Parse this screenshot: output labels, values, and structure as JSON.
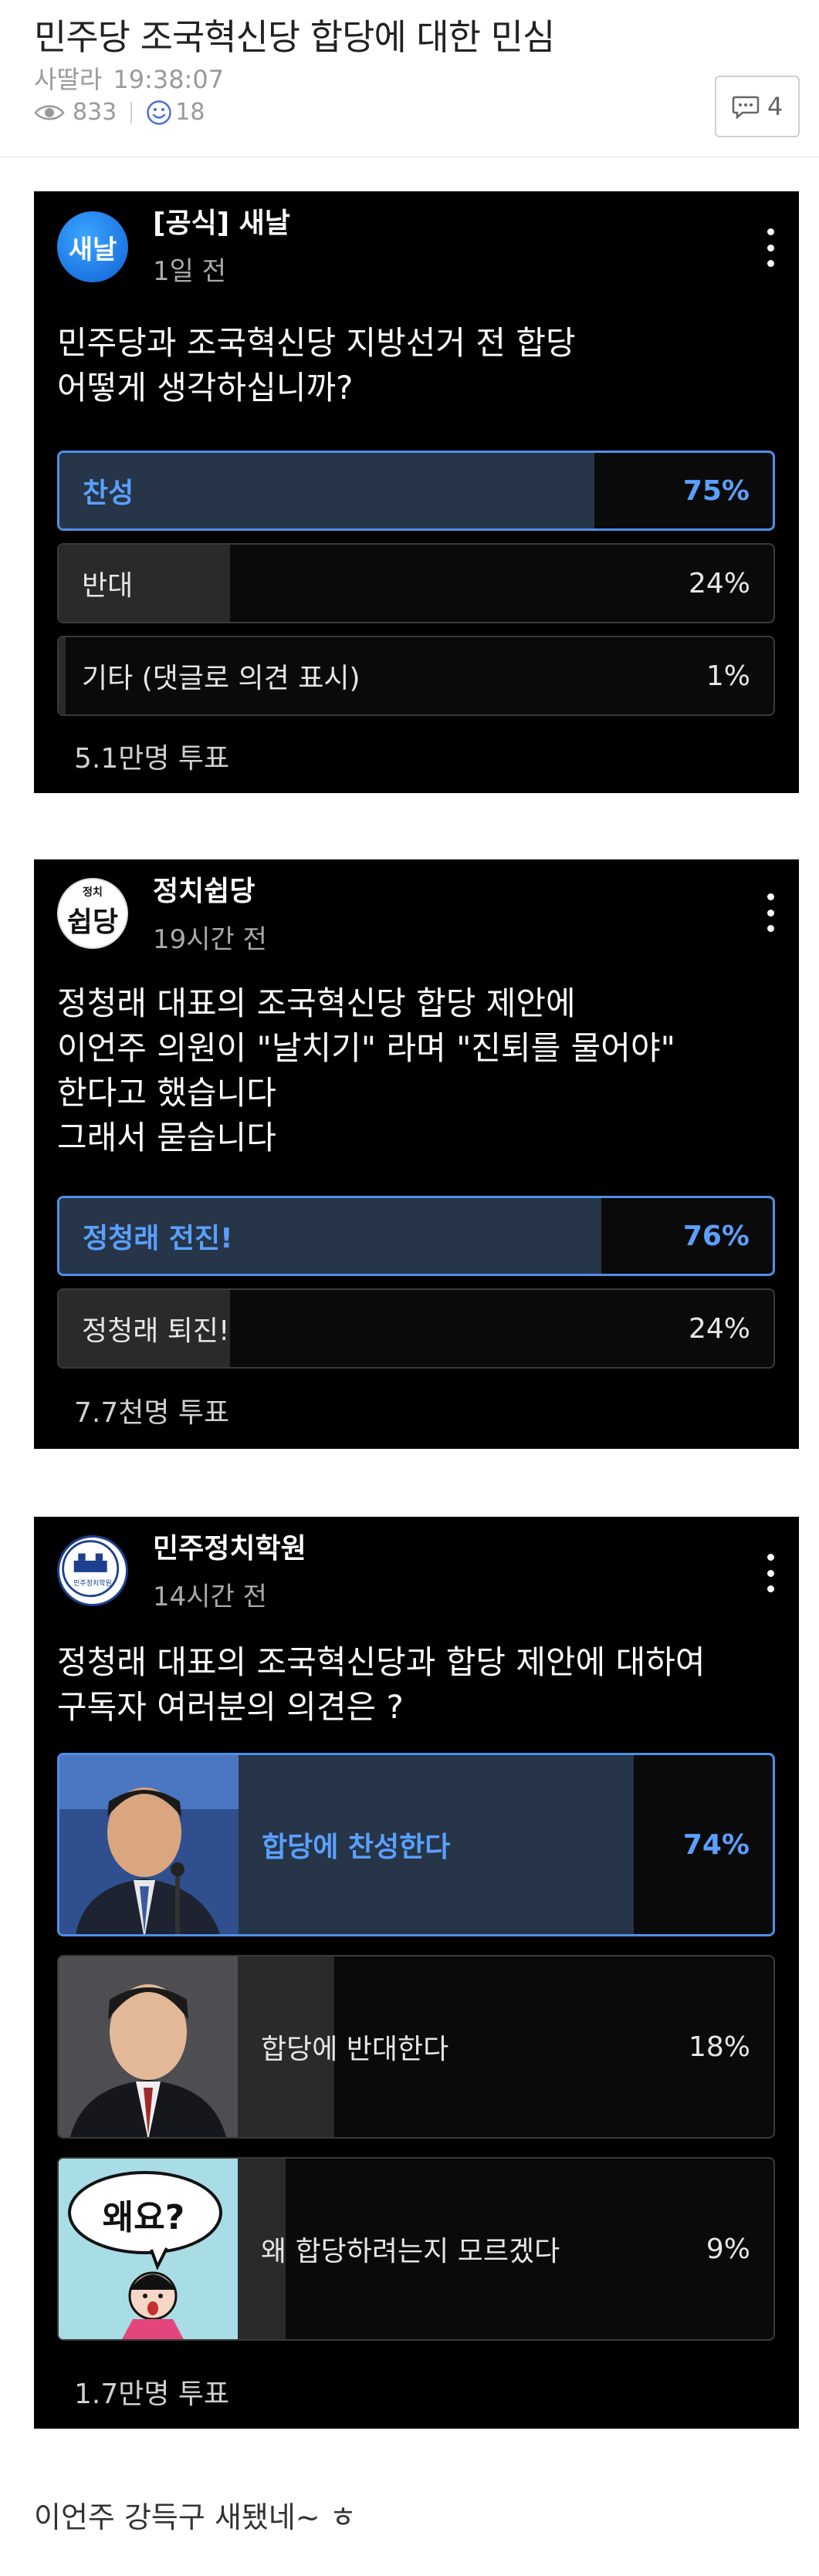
{
  "post": {
    "title": "민주당 조국혁신당 합당에 대한 민심",
    "author": "사딸라",
    "time": "19:38:07",
    "views": "833",
    "likes": "18",
    "comments": "4"
  },
  "polls": [
    {
      "channel": "[공식] 새날",
      "avatar_text": "새날",
      "time": "1일 전",
      "question": "민주당과 조국혁신당 지방선거 전 합당\n어떻게 생각하십니까?",
      "options": [
        {
          "label": "찬성",
          "pct_text": "75%",
          "pct": 75,
          "selected": true
        },
        {
          "label": "반대",
          "pct_text": "24%",
          "pct": 24,
          "selected": false
        },
        {
          "label": "기타 (댓글로 의견 표시)",
          "pct_text": "1%",
          "pct": 1,
          "selected": false
        }
      ],
      "votes": "5.1만명 투표"
    },
    {
      "channel": "정치쉽당",
      "avatar_text": "쉽당",
      "avatar_small_text": "정치",
      "time": "19시간 전",
      "question": "정청래 대표의 조국혁신당 합당 제안에\n이언주 의원이 \"날치기\" 라며 \"진퇴를 물어야\"\n한다고 했습니다\n그래서 묻습니다",
      "options": [
        {
          "label": "정청래 전진!",
          "pct_text": "76%",
          "pct": 76,
          "selected": true
        },
        {
          "label": "정청래 퇴진!",
          "pct_text": "24%",
          "pct": 24,
          "selected": false
        }
      ],
      "votes": "7.7천명 투표"
    },
    {
      "channel": "민주정치학원",
      "avatar_text": "민주정치학원",
      "time": "14시간 전",
      "question": "정청래 대표의 조국혁신당과 합당 제안에 대하여\n구독자 여러분의 의견은 ?",
      "options": [
        {
          "label": "합당에 찬성한다",
          "pct_text": "74%",
          "pct": 74,
          "selected": true
        },
        {
          "label": "합당에 반대한다",
          "pct_text": "18%",
          "pct": 18,
          "selected": false
        },
        {
          "label": "왜 합당하려는지 모르겠다",
          "pct_text": "9%",
          "pct": 9,
          "selected": false,
          "thumb_text": "왜요?"
        }
      ],
      "votes": "1.7만명 투표"
    }
  ],
  "footer": {
    "text": "이언주 강득구 새됐네~ ㅎ"
  },
  "colors": {
    "accent": "#5aa0ff",
    "card_bg": "#000000",
    "selected_fill": "#263548",
    "fill": "#2a2a2a"
  }
}
